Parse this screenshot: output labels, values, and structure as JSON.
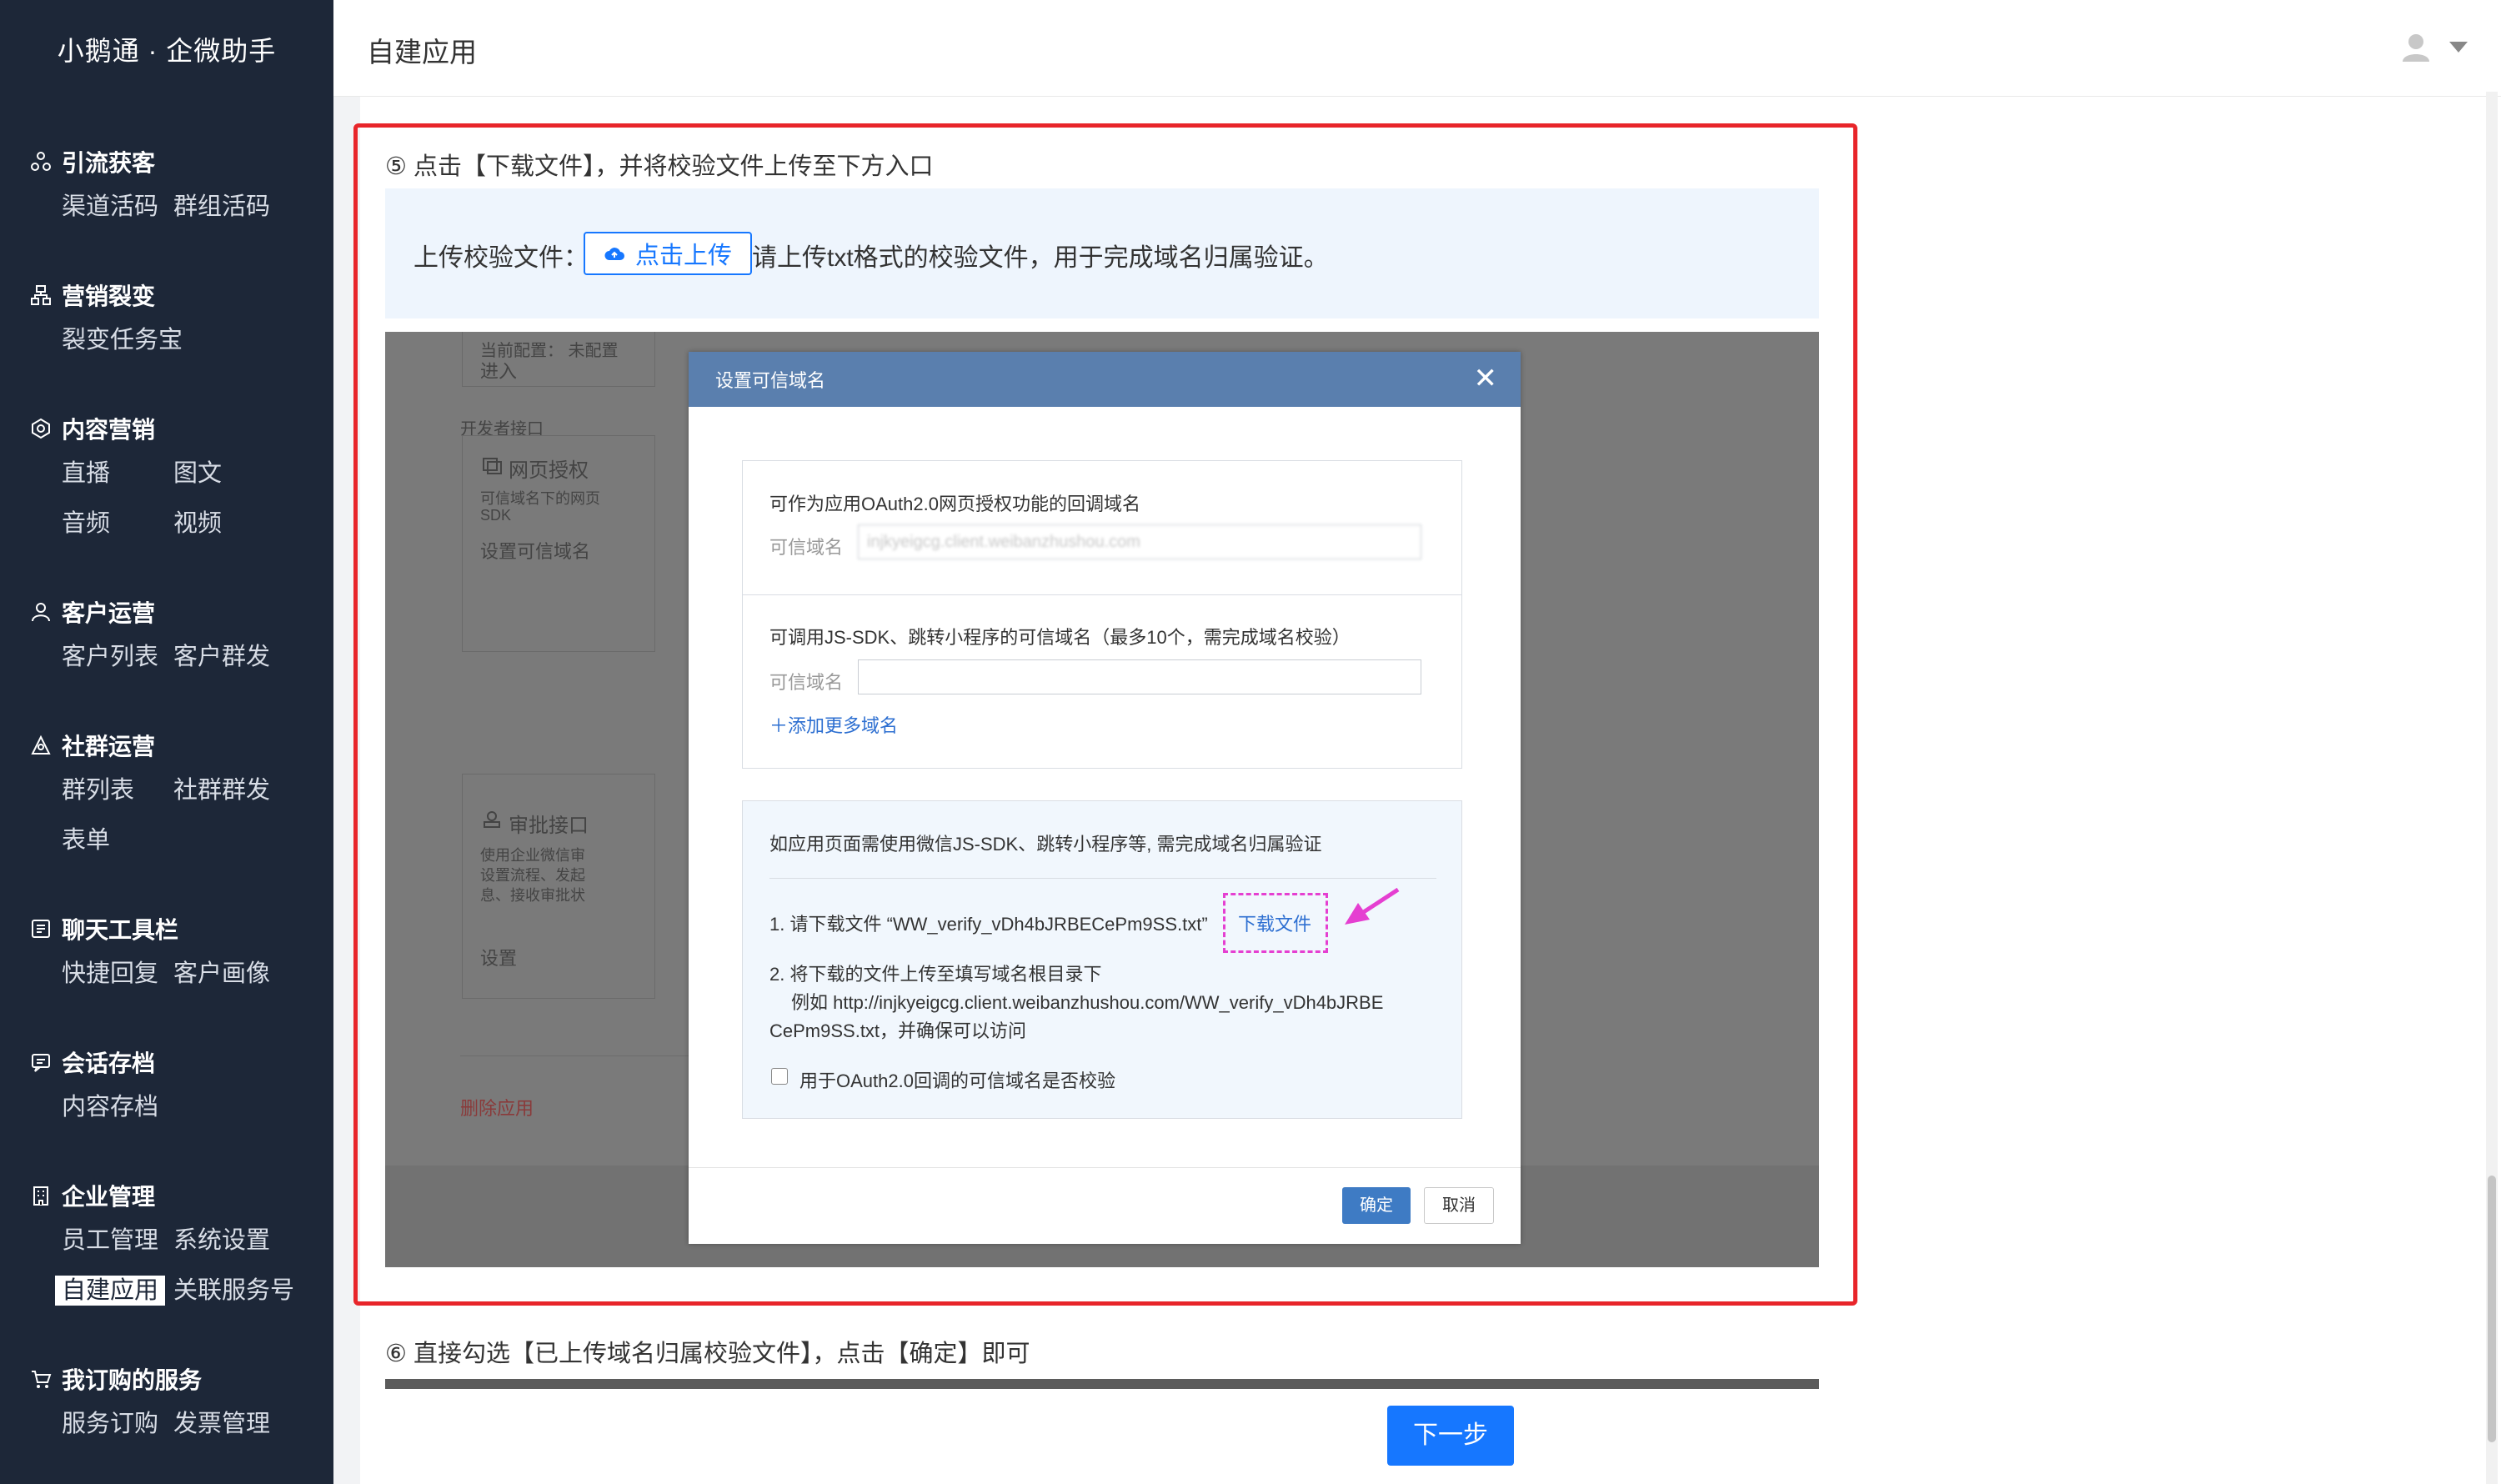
{
  "app": {
    "brand": "小鹅通 · 企微助手"
  },
  "header": {
    "title": "自建应用"
  },
  "sidebar": {
    "groups": [
      {
        "title": "引流获客",
        "icon": "share-nodes-icon",
        "items": [
          "渠道活码",
          "群组活码"
        ]
      },
      {
        "title": "营销裂变",
        "icon": "org-chart-icon",
        "items": [
          "裂变任务宝"
        ]
      },
      {
        "title": "内容营销",
        "icon": "hexagon-icon",
        "items": [
          "直播",
          "图文",
          "音频",
          "视频"
        ]
      },
      {
        "title": "客户运营",
        "icon": "person-icon",
        "items": [
          "客户列表",
          "客户群发"
        ]
      },
      {
        "title": "社群运营",
        "icon": "group-icon",
        "items": [
          "群列表",
          "社群群发",
          "表单"
        ]
      },
      {
        "title": "聊天工具栏",
        "icon": "chat-tool-icon",
        "items": [
          "快捷回复",
          "客户画像"
        ]
      },
      {
        "title": "会话存档",
        "icon": "archive-chat-icon",
        "items": [
          "内容存档"
        ]
      },
      {
        "title": "企业管理",
        "icon": "building-icon",
        "items": [
          "员工管理",
          "系统设置",
          "自建应用",
          "关联服务号"
        ]
      },
      {
        "title": "我订购的服务",
        "icon": "cart-icon",
        "items": [
          "服务订购",
          "发票管理"
        ]
      }
    ],
    "active_item": "自建应用"
  },
  "step5": {
    "text": "⑤ 点击【下载文件】，并将校验文件上传至下方入口"
  },
  "upload": {
    "label": "上传校验文件：",
    "button": "点击上传",
    "hint": "请上传txt格式的校验文件，用于完成域名归属验证。"
  },
  "background_page": {
    "config_status": "当前配置：  未配置",
    "enter": "进入",
    "dev_api": "开发者接口",
    "web_auth": "网页授权",
    "web_auth_desc_1": "可信域名下的网页",
    "web_auth_desc_2": "SDK",
    "set_domain": "设置可信域名",
    "approval": "审批接口",
    "approval_desc_1": "使用企业微信审",
    "approval_desc_2": "设置流程、发起",
    "approval_desc_3": "息、接收审批状",
    "settings": "设置",
    "delete_app": "删除应用"
  },
  "dialog": {
    "title": "设置可信域名",
    "oauth_title": "可作为应用OAuth2.0网页授权功能的回调域名",
    "domain_label": "可信域名",
    "oauth_domain_value": "injkyeigcg.client.weibanzhushou.com",
    "jssdk_title": "可调用JS-SDK、跳转小程序的可信域名（最多10个，需完成域名校验）",
    "jssdk_domain_label": "可信域名",
    "add_more": "添加更多域名",
    "verify_title": "如应用页面需使用微信JS-SDK、跳转小程序等, 需完成域名归属验证",
    "verify_step1": "1. 请下载文件 “WW_verify_vDh4bJRBECePm9SS.txt”",
    "download_link": "下载文件",
    "verify_step2": "2. 将下载的文件上传至填写域名根目录下",
    "verify_example_1": "例如 http://injkyeigcg.client.weibanzhushou.com/WW_verify_vDh4bJRBE",
    "verify_example_2": "CePm9SS.txt，并确保可以访问",
    "checkbox_label": "用于OAuth2.0回调的可信域名是否校验",
    "ok": "确定",
    "cancel": "取消"
  },
  "step6": {
    "text": "⑥ 直接勾选【已上传域名归属校验文件】，点击【确定】即可"
  },
  "footer": {
    "next": "下一步"
  },
  "colors": {
    "sidebar_bg": "#1d2738",
    "primary": "#1677ff",
    "highlight": "#e8252a",
    "dialog_header": "#5a7fae",
    "annotation": "#e53fd1"
  }
}
